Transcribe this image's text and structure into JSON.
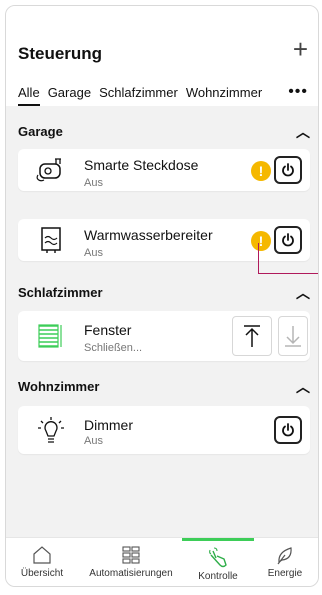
{
  "header": {
    "title": "Steuerung"
  },
  "tabs": [
    {
      "label": "Alle",
      "active": true
    },
    {
      "label": "Garage",
      "active": false
    },
    {
      "label": "Schlafzimmer",
      "active": false
    },
    {
      "label": "Wohnzimmer",
      "active": false
    }
  ],
  "sections": [
    {
      "title": "Garage",
      "devices": [
        {
          "name": "Smarte Steckdose",
          "status": "Aus",
          "icon": "smart-plug-icon",
          "warning": true
        },
        {
          "name": "Warmwasserbereiter",
          "status": "Aus",
          "icon": "water-heater-icon",
          "warning": true
        }
      ]
    },
    {
      "title": "Schlafzimmer",
      "devices": [
        {
          "name": "Fenster",
          "status": "Schließen...",
          "icon": "shutter-icon"
        }
      ]
    },
    {
      "title": "Wohnzimmer",
      "devices": [
        {
          "name": "Dimmer",
          "status": "Aus",
          "icon": "dimmer-icon"
        }
      ]
    }
  ],
  "bottom_nav": [
    {
      "label": "Übersicht",
      "icon": "home-icon"
    },
    {
      "label": "Automatisierungen",
      "icon": "grid-icon"
    },
    {
      "label": "Kontrolle",
      "icon": "hand-tap-icon",
      "active": true
    },
    {
      "label": "Energie",
      "icon": "leaf-icon"
    }
  ],
  "colors": {
    "accent": "#3dcd58",
    "warning": "#f5b800",
    "callout": "#b01a5b"
  }
}
